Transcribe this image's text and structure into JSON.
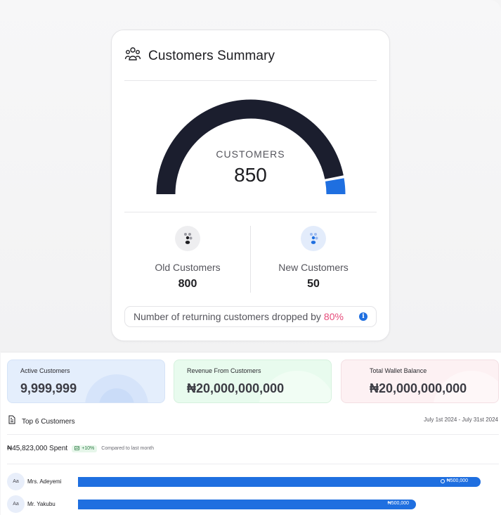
{
  "summary": {
    "title": "Customers Summary",
    "gauge": {
      "label": "CUSTOMERS",
      "value": "850"
    },
    "old": {
      "label": "Old Customers",
      "value": "800"
    },
    "new": {
      "label": "New Customers",
      "value": "50"
    },
    "notice": {
      "text": "Number of returning customers dropped by",
      "percent": "80%",
      "info_icon": "i"
    }
  },
  "chart_data": {
    "type": "gauge",
    "title": "",
    "total": 850,
    "series": [
      {
        "name": "Old Customers",
        "value": 800,
        "color": "#1b1e2e"
      },
      {
        "name": "New Customers",
        "value": 50,
        "color": "#1f6fe0"
      }
    ]
  },
  "kpis": [
    {
      "title": "Active Customers",
      "value": "9,999,999"
    },
    {
      "title": "Revenue From Customers",
      "value": "₦20,000,000,000"
    },
    {
      "title": "Total Wallet Balance",
      "value": "₦20,000,000,000"
    }
  ],
  "top": {
    "title": "Top 6 Customers",
    "date_range": "July 1st 2024 - July 31st 2024",
    "spent": "₦45,823,000 Spent",
    "badge": "+10%",
    "compared": "Compared to last month",
    "customers": [
      {
        "avatar": "Aa",
        "name": "Mrs. Adeyemi",
        "amount": "₦500,000",
        "bar_fraction": 1.0
      },
      {
        "avatar": "Aa",
        "name": "Mr. Yakubu",
        "amount": "₦500,000",
        "bar_fraction": 0.84
      }
    ]
  },
  "colors": {
    "accent": "#1f6fe0",
    "dark": "#1b1e2e",
    "alert": "#e64b7a"
  }
}
